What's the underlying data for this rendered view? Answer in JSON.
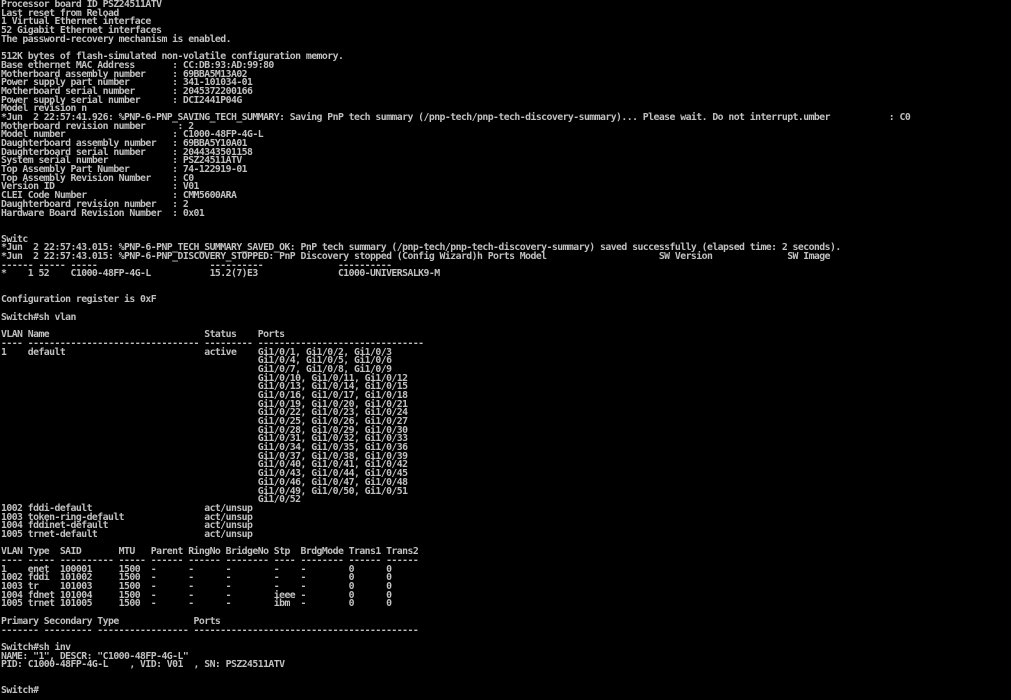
{
  "terminal": {
    "lines": [
      "Processor board ID PSZ24511ATV",
      "Last reset from Reload",
      "1 Virtual Ethernet interface",
      "52 Gigabit Ethernet interfaces",
      "The password-recovery mechanism is enabled.",
      "",
      "512K bytes of flash-simulated non-volatile configuration memory.",
      "Base ethernet MAC Address       : CC:DB:93:AD:99:80",
      "Motherboard assembly number     : 69BBA5M13A02",
      "Power supply part number        : 341-101034-01",
      "Motherboard serial number       : 2045372200166",
      "Power supply serial number      : DCI2441P04G",
      "Model revision n",
      "*Jun  2 22:57:41.926: %PNP-6-PNP_SAVING_TECH_SUMMARY: Saving PnP tech summary (/pnp-tech/pnp-tech-discovery-summary)... Please wait. Do not interrupt.umber           : C0",
      "Motherboard revision number      : 2",
      "Model number                    : C1000-48FP-4G-L",
      "Daughterboard assembly number   : 69BBA5Y10A01",
      "Daughterboard serial number     : 2044343501158",
      "System serial number            : PSZ24511ATV",
      "Top Assembly Part Number        : 74-122919-01",
      "Top Assembly Revision Number    : C0",
      "Version ID                      : V01",
      "CLEI Code Number                : CMM5600ARA",
      "Daughterboard revision number   : 2",
      "Hardware Board Revision Number  : 0x01",
      "",
      "",
      "Switc",
      "*Jun  2 22:57:43.015: %PNP-6-PNP_TECH_SUMMARY_SAVED_OK: PnP tech summary (/pnp-tech/pnp-tech-discovery-summary) saved successfully (elapsed time: 2 seconds).",
      "*Jun  2 22:57:43.015: %PNP-6-PNP_DISCOVERY_STOPPED: PnP Discovery stopped (Config Wizard)h Ports Model                     SW Version              SW Image",
      "------ ----- -----                     ----------              ----------",
      "*    1 52    C1000-48FP-4G-L           15.2(7)E3               C1000-UNIVERSALK9-M",
      "",
      "",
      "Configuration register is 0xF",
      "",
      "Switch#sh vlan",
      "",
      "VLAN Name                             Status    Ports",
      "---- -------------------------------- --------- -------------------------------",
      "1    default                          active    Gi1/0/1, Gi1/0/2, Gi1/0/3",
      "                                                Gi1/0/4, Gi1/0/5, Gi1/0/6",
      "                                                Gi1/0/7, Gi1/0/8, Gi1/0/9",
      "                                                Gi1/0/10, Gi1/0/11, Gi1/0/12",
      "                                                Gi1/0/13, Gi1/0/14, Gi1/0/15",
      "                                                Gi1/0/16, Gi1/0/17, Gi1/0/18",
      "                                                Gi1/0/19, Gi1/0/20, Gi1/0/21",
      "                                                Gi1/0/22, Gi1/0/23, Gi1/0/24",
      "                                                Gi1/0/25, Gi1/0/26, Gi1/0/27",
      "                                                Gi1/0/28, Gi1/0/29, Gi1/0/30",
      "                                                Gi1/0/31, Gi1/0/32, Gi1/0/33",
      "                                                Gi1/0/34, Gi1/0/35, Gi1/0/36",
      "                                                Gi1/0/37, Gi1/0/38, Gi1/0/39",
      "                                                Gi1/0/40, Gi1/0/41, Gi1/0/42",
      "                                                Gi1/0/43, Gi1/0/44, Gi1/0/45",
      "                                                Gi1/0/46, Gi1/0/47, Gi1/0/48",
      "                                                Gi1/0/49, Gi1/0/50, Gi1/0/51",
      "                                                Gi1/0/52",
      "1002 fddi-default                     act/unsup",
      "1003 token-ring-default               act/unsup",
      "1004 fddinet-default                  act/unsup",
      "1005 trnet-default                    act/unsup",
      "",
      "VLAN Type  SAID       MTU   Parent RingNo BridgeNo Stp  BrdgMode Trans1 Trans2",
      "---- ----- ---------- ----- ------ ------ -------- ---- -------- ------ ------",
      "1    enet  100001     1500  -      -      -        -    -        0      0",
      "1002 fddi  101002     1500  -      -      -        -    -        0      0",
      "1003 tr    101003     1500  -      -      -        -    -        0      0",
      "1004 fdnet 101004     1500  -      -      -        ieee -        0      0",
      "1005 trnet 101005     1500  -      -      -        ibm  -        0      0",
      "",
      "Primary Secondary Type              Ports",
      "------- --------- ----------------- ------------------------------------------",
      "",
      "Switch#sh inv",
      "NAME: \"1\", DESCR: \"C1000-48FP-4G-L\"",
      "PID: C1000-48FP-4G-L    , VID: V01  , SN: PSZ24511ATV",
      "",
      "",
      "Switch#"
    ]
  }
}
